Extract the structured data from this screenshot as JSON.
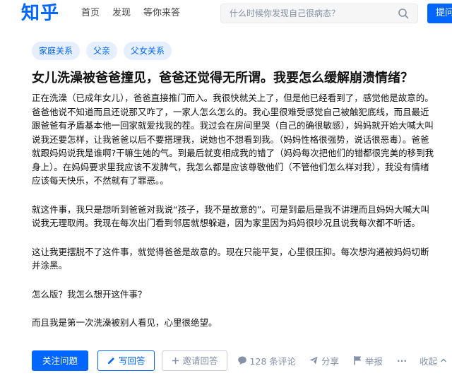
{
  "header": {
    "logo": "知乎",
    "nav": [
      {
        "label": "首页"
      },
      {
        "label": "发现"
      },
      {
        "label": "等你来答"
      }
    ],
    "search_placeholder": "什么时候你发现自己很病态？",
    "ask_label": "提问"
  },
  "question": {
    "tags": [
      "家庭关系",
      "父亲",
      "父女关系"
    ],
    "title": "女儿洗澡被爸爸撞见，爸爸还觉得无所谓。我要怎么缓解崩溃情绪？",
    "paragraphs": [
      "正在洗澡（已成年女儿），爸爸直接推门而入。我很快就关上了，但是他已经看到了，感觉他是故意的。爸爸他说不知道而且还说那又咋了，一家人怎么怎么的。我心里很难受感觉自己被触犯底线，而且最近跟爸爸有矛盾基本他一回家就爱找我的茬。我过会在房间里哭（自己的确很敏感），妈妈就开始大喊大叫说我还要怎样，让我爸爸以后不要搭理我，说她也不想看到我。（妈妈性格很强势，说话很恶毒）。爸爸就跟妈妈说我是谁啊?干嘛生她的气。到最后就变相成我的错了（妈妈每次把他们的错都很完美的移到我身上）。在妈妈要求里我应该不发脾气，我怎么都是应该尊敬他们（不管他们怎么样对我），我没有情绪应该每天快乐，不然就有了罪恶。。",
      "就这件事，我只是想听到爸爸对我说“孩子，我不是故意的”。可是到最后是我不讲理而且妈妈大喊大叫说我无理取闹。我现在每次出门看到邻居就想躲避，因为家里因为妈妈很吵况且说我每次都不听话。",
      "这让我更摆脱不了这件事，就觉得爸爸是故意的。现在只能平复，心里很压抑。每次想沟通被妈妈切断并涂黑。",
      "怎么版？我怎么想开这件事？",
      "而且我是第一次洗澡被别人看见，心里很绝望。"
    ]
  },
  "actions": {
    "follow": "关注问题",
    "answer": "写回答",
    "invite": "邀请回答",
    "comments": "128 条评论",
    "share": "分享",
    "report": "举报",
    "more": "···",
    "collapse": "收起"
  }
}
